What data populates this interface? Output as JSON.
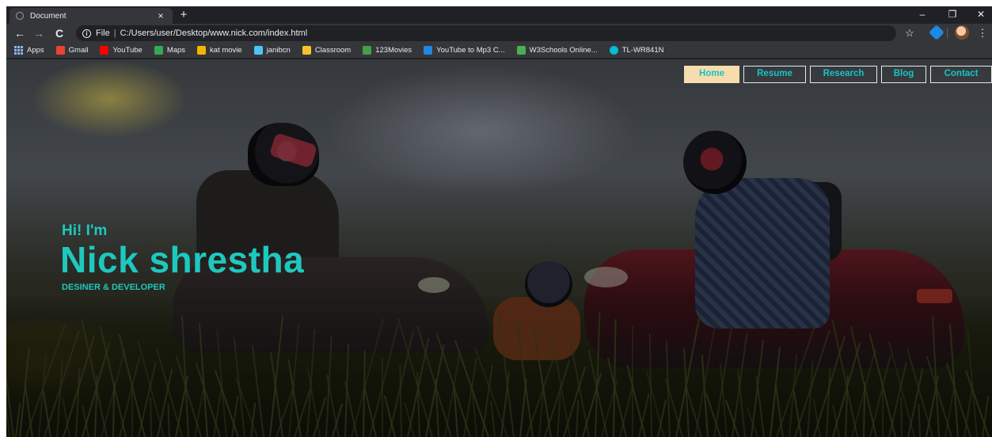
{
  "browser": {
    "tab": {
      "title": "Document",
      "close": "×"
    },
    "new_tab": "+",
    "window_controls": {
      "minimize": "–",
      "restore": "❐",
      "close": "✕"
    },
    "nav": {
      "back": "←",
      "forward": "→",
      "reload": "C"
    },
    "address": {
      "scheme": "File",
      "separator": "|",
      "path": "C:/Users/user/Desktop/www.nick.com/index.html"
    },
    "star": "☆",
    "menu": "⋮",
    "bookmarks": [
      {
        "label": "Apps",
        "icon": "apps-icon",
        "color": "#8ab4f8"
      },
      {
        "label": "Gmail",
        "icon": "gmail-icon",
        "color": "#ea4335"
      },
      {
        "label": "YouTube",
        "icon": "youtube-icon",
        "color": "#ff0000"
      },
      {
        "label": "Maps",
        "icon": "maps-icon",
        "color": "#34a853"
      },
      {
        "label": "kat movie",
        "icon": "kat-movie-icon",
        "color": "#f4b400"
      },
      {
        "label": "janibcn",
        "icon": "janibcn-icon",
        "color": "#4fc3f7"
      },
      {
        "label": "Classroom",
        "icon": "classroom-icon",
        "color": "#fbc02d"
      },
      {
        "label": "123Movies",
        "icon": "123movies-icon",
        "color": "#43a047"
      },
      {
        "label": "YouTube to Mp3 C...",
        "icon": "youtube-mp3-icon",
        "color": "#1e88e5"
      },
      {
        "label": "W3Schools Online...",
        "icon": "w3schools-icon",
        "color": "#4caf50"
      },
      {
        "label": "TL-WR841N",
        "icon": "tplink-icon",
        "color": "#00bcd4"
      }
    ]
  },
  "site": {
    "nav": [
      {
        "label": "Home",
        "active": true
      },
      {
        "label": "Resume",
        "active": false
      },
      {
        "label": "Research",
        "active": false
      },
      {
        "label": "Blog",
        "active": false
      },
      {
        "label": "Contact",
        "active": false
      }
    ],
    "hero": {
      "greeting": "Hi! I'm",
      "name": "Nick shrestha",
      "role": "DESINER & DEVELOPER"
    },
    "accent_color": "#1ec8be",
    "active_nav_color": "#f7dcae"
  }
}
